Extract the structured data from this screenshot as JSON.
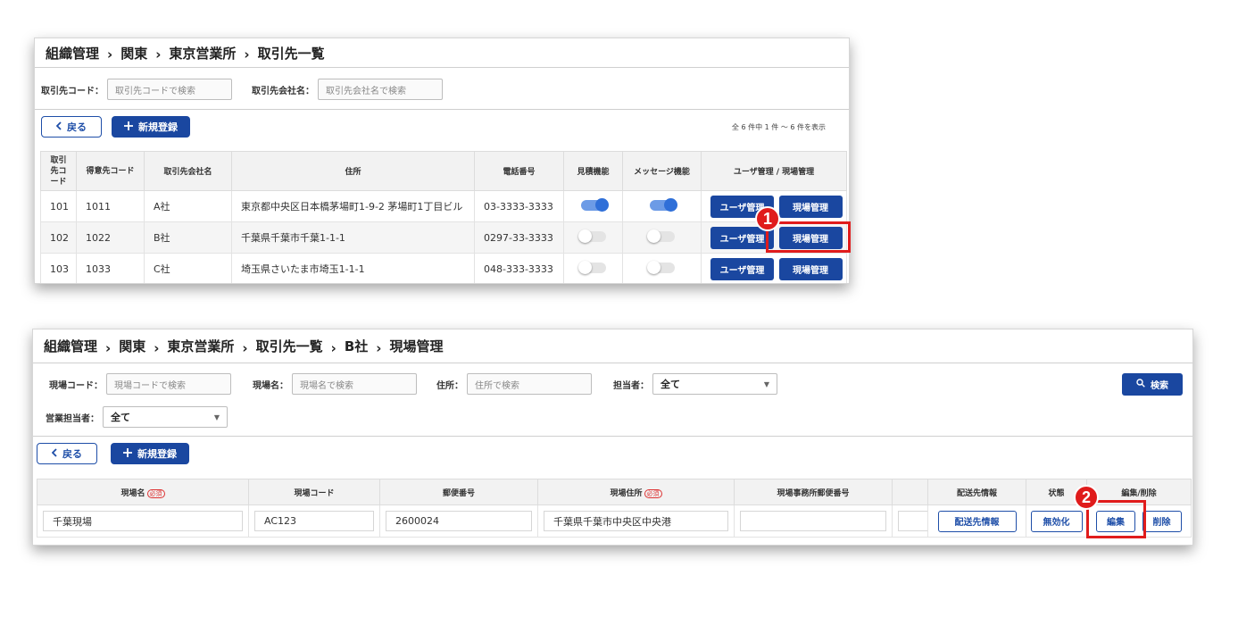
{
  "panel1": {
    "breadcrumb": [
      "組織管理",
      "関東",
      "東京営業所",
      "取引先一覧"
    ],
    "separator": "›",
    "filters": {
      "code_label": "取引先コード：",
      "code_placeholder": "取引先コードで検索",
      "name_label": "取引先会社名：",
      "name_placeholder": "取引先会社名で検索"
    },
    "back_label": "戻る",
    "new_label": "新規登録",
    "count_text": "全 6 件中 1 件 ～ 6 件を表示",
    "headers": [
      "取引先コード",
      "得意先コード",
      "取引先会社名",
      "住所",
      "電話番号",
      "見積機能",
      "メッセージ機能",
      "ユーザ管理 / 現場管理"
    ],
    "rows": [
      {
        "code": "101",
        "customer_code": "1011",
        "company": "A社",
        "address": "東京都中央区日本橋茅場町1-9-2 茅場町1丁目ビル",
        "phone": "03-3333-3333",
        "estimate": "on",
        "message": "on"
      },
      {
        "code": "102",
        "customer_code": "1022",
        "company": "B社",
        "address": "千葉県千葉市千葉1-1-1",
        "phone": "0297-33-3333",
        "estimate": "off",
        "message": "off"
      },
      {
        "code": "103",
        "customer_code": "1033",
        "company": "C社",
        "address": "埼玉県さいたま市埼玉1-1-1",
        "phone": "048-333-3333",
        "estimate": "off",
        "message": "off"
      }
    ],
    "user_btn_label": "ユーザ管理",
    "site_btn_label": "現場管理",
    "badge": "1"
  },
  "panel2": {
    "breadcrumb": [
      "組織管理",
      "関東",
      "東京営業所",
      "取引先一覧",
      "B社",
      "現場管理"
    ],
    "separator": "›",
    "filters": {
      "site_code_label": "現場コード：",
      "site_code_placeholder": "現場コードで検索",
      "site_name_label": "現場名：",
      "site_name_placeholder": "現場名で検索",
      "address_label": "住所：",
      "address_placeholder": "住所で検索",
      "manager_label": "担当者：",
      "manager_value": "全て",
      "sales_label": "営業担当者：",
      "sales_value": "全て"
    },
    "search_label": "検索",
    "back_label": "戻る",
    "new_label": "新規登録",
    "headers": [
      "現場名",
      "現場コード",
      "郵便番号",
      "現場住所",
      "現場事務所郵便番号",
      "",
      "配送先情報",
      "状態",
      "編集/削除"
    ],
    "required_tag": "必須",
    "row": {
      "site_name": "千葉現場",
      "site_code": "AC123",
      "postal": "2600024",
      "site_address": "千葉県千葉市中央区中央港",
      "office_postal": "",
      "delivery_btn": "配送先情報",
      "status_btn": "無効化",
      "edit_btn": "編集",
      "delete_btn": "削除"
    },
    "badge": "2"
  }
}
